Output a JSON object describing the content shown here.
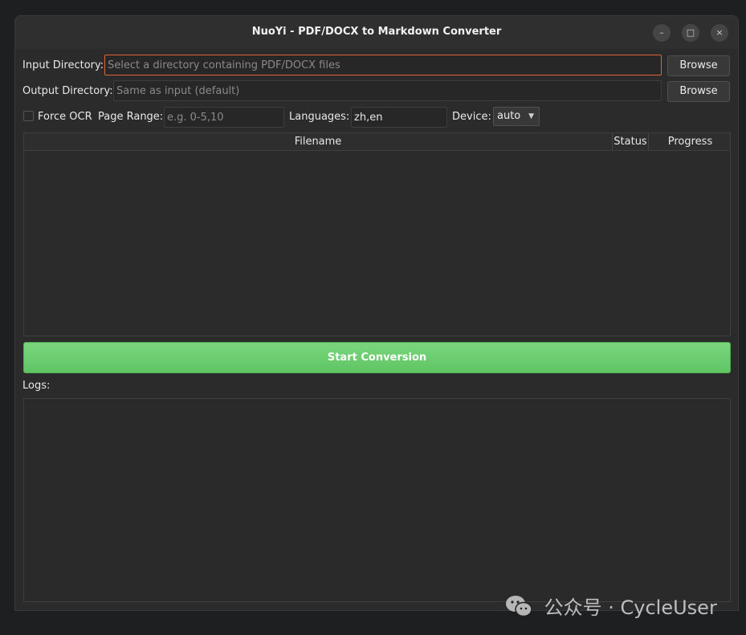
{
  "window": {
    "title": "NuoYi - PDF/DOCX to Markdown Converter",
    "controls": {
      "minimize": "–",
      "maximize": "□",
      "close": "×"
    }
  },
  "input_dir": {
    "label": "Input Directory:",
    "placeholder": "Select a directory containing PDF/DOCX files",
    "value": "",
    "browse_label": "Browse"
  },
  "output_dir": {
    "label": "Output Directory:",
    "placeholder": "Same as input (default)",
    "value": "",
    "browse_label": "Browse"
  },
  "options": {
    "force_ocr_label": "Force OCR",
    "force_ocr_checked": false,
    "page_range_label": "Page Range:",
    "page_range_placeholder": "e.g. 0-5,10",
    "languages_label": "Languages:",
    "languages_value": "zh,en",
    "device_label": "Device:",
    "device_value": "auto"
  },
  "table": {
    "columns": [
      "Filename",
      "Status",
      "Progress"
    ],
    "rows": []
  },
  "start_button_label": "Start Conversion",
  "logs": {
    "label": "Logs:",
    "content": ""
  },
  "watermark": {
    "text": "公众号 · CycleUser"
  },
  "colors": {
    "accent_focus": "#e0633a",
    "start_button": "#6fcf73",
    "background": "#2b2b2b"
  }
}
